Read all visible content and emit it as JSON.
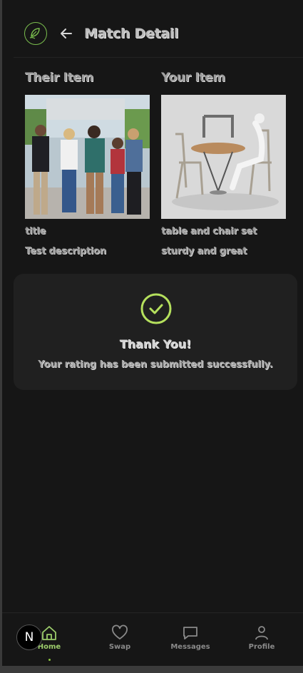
{
  "header": {
    "title": "Match Detail",
    "logo_icon": "leaf-logo-icon",
    "back_icon": "arrow-left-icon"
  },
  "their_item": {
    "heading": "Their Item",
    "image_desc": "group-of-students-photo",
    "title": "title",
    "description": "Test description"
  },
  "your_item": {
    "heading": "Your Item",
    "image_desc": "table-and-chairs-photo",
    "title": "table and chair set",
    "description": "sturdy and great"
  },
  "confirmation": {
    "icon": "check-circle-icon",
    "heading": "Thank You!",
    "message": "Your rating has been submitted successfully."
  },
  "nav": {
    "items": [
      {
        "label": "Home",
        "icon": "home-icon",
        "active": true
      },
      {
        "label": "Swap",
        "icon": "heart-icon",
        "active": false
      },
      {
        "label": "Messages",
        "icon": "message-icon",
        "active": false
      },
      {
        "label": "Profile",
        "icon": "user-icon",
        "active": false
      }
    ]
  },
  "dev_badge": {
    "label": "N"
  },
  "colors": {
    "background": "#161616",
    "card": "#202020",
    "accent": "#9ccc6b",
    "check": "#b5e05d"
  }
}
